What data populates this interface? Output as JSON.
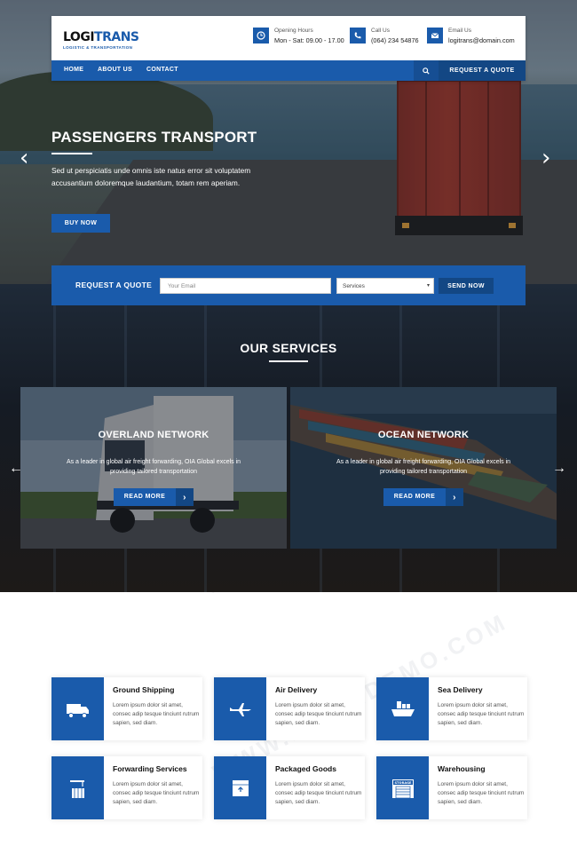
{
  "brand": {
    "name_dark": "LOGI",
    "name_accent": "TRANS",
    "tagline": "LOGISTIC & TRANSPORTATION"
  },
  "header": {
    "hours_label": "Opening Hours",
    "hours_value": "Mon - Sat: 09.00 - 17.00",
    "call_label": "Call Us",
    "call_value": "(064) 234 54876",
    "email_label": "Email Us",
    "email_value": "logitrans@domain.com"
  },
  "nav": {
    "items": [
      "HOME",
      "ABOUT US",
      "CONTACT"
    ],
    "quote_button": "REQUEST A QUOTE"
  },
  "hero": {
    "title": "PASSENGERS TRANSPORT",
    "text": "Sed ut perspiciatis unde omnis iste natus error sit voluptatem accusantium doloremque laudantium, totam rem aperiam.",
    "button": "BUY NOW"
  },
  "quote_form": {
    "label": "REQUEST A QUOTE",
    "email_placeholder": "Your Email",
    "service_selected": "Services",
    "send": "SEND NOW"
  },
  "services": {
    "title": "OUR SERVICES",
    "cards": [
      {
        "title": "OVERLAND NETWORK",
        "desc": "As a leader in global air freight forwarding, OIA Global excels in providing tailored transportation",
        "button": "READ MORE"
      },
      {
        "title": "OCEAN NETWORK",
        "desc": "As a leader in global air freight forwarding, OIA Global excels in providing tailored transportation",
        "button": "READ MORE"
      }
    ]
  },
  "features": [
    {
      "title": "Ground Shipping",
      "desc": "Lorem ipsum dolor sit amet, consec adip tesque tinciunt rutrum sapien, sed diam.",
      "icon": "truck-icon"
    },
    {
      "title": "Air Delivery",
      "desc": "Lorem ipsum dolor sit amet, consec adip tesque tinciunt rutrum sapien, sed diam.",
      "icon": "airplane-icon"
    },
    {
      "title": "Sea Delivery",
      "desc": "Lorem ipsum dolor sit amet, consec adip tesque tinciunt rutrum sapien, sed diam.",
      "icon": "ship-icon"
    },
    {
      "title": "Forwarding Services",
      "desc": "Lorem ipsum dolor sit amet, consec adip tesque tinciunt rutrum sapien, sed diam.",
      "icon": "crane-icon"
    },
    {
      "title": "Packaged Goods",
      "desc": "Lorem ipsum dolor sit amet, consec adip tesque tinciunt rutrum sapien, sed diam.",
      "icon": "package-icon"
    },
    {
      "title": "Warehousing",
      "desc": "Lorem ipsum dolor sit amet, consec adip tesque tinciunt rutrum sapien, sed diam.",
      "icon": "warehouse-icon",
      "icon_text": "STORAGE"
    }
  ],
  "colors": {
    "primary": "#1a5bab",
    "primary_dark": "#134784"
  },
  "watermark": "WWW.DOWNDEMO.COM"
}
